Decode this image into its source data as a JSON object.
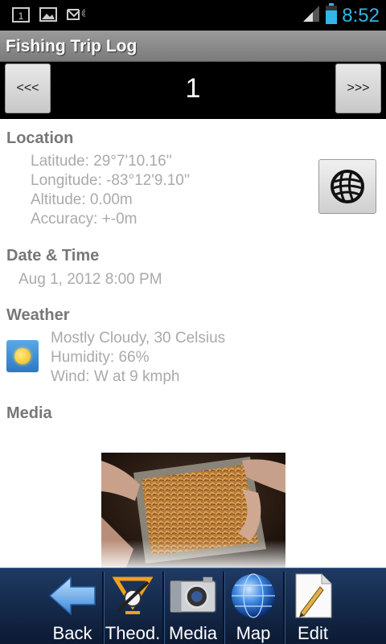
{
  "status_bar": {
    "time": "8:52",
    "icons": [
      "calendar-icon",
      "image-icon",
      "missed-message-icon",
      "signal-icon",
      "battery-icon"
    ],
    "calendar_day": "1"
  },
  "app": {
    "title": "Fishing Trip Log"
  },
  "nav": {
    "prev_label": "<<<",
    "next_label": ">>>",
    "page": "1"
  },
  "location": {
    "heading": "Location",
    "latitude": "Latitude: 29°7'10.16''",
    "longitude": "Longitude: -83°12'9.10''",
    "altitude": "Altitude: 0.00m",
    "accuracy": "Accuracy: +-0m",
    "button_icon": "globe-icon"
  },
  "datetime": {
    "heading": "Date & Time",
    "value": "Aug 1, 2012 8:00 PM"
  },
  "weather": {
    "heading": "Weather",
    "icon": "sunny-weather-icon",
    "condition": "Mostly Cloudy, 30 Celsius",
    "humidity": "Humidity: 66%",
    "wind": "Wind: W at 9 kmph"
  },
  "media": {
    "heading": "Media",
    "image": "bait-tray-photo"
  },
  "toolbar": {
    "items": [
      {
        "label": "Back",
        "icon": "back-arrow-icon"
      },
      {
        "label": "Theod.",
        "icon": "theodolite-icon"
      },
      {
        "label": "Media",
        "icon": "camera-icon"
      },
      {
        "label": "Map",
        "icon": "globe-icon"
      },
      {
        "label": "Edit",
        "icon": "edit-pencil-icon"
      }
    ]
  },
  "colors": {
    "clock": "#33b5e5",
    "section_heading": "#777777",
    "detail_text": "#aaaaaa",
    "toolbar_bg": "#1f3a63"
  }
}
